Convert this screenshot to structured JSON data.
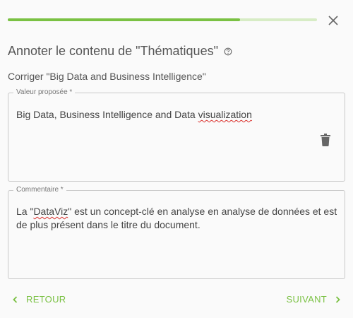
{
  "progress": {
    "fraction": 0.75
  },
  "header": {
    "title": "Annoter le contenu de \"Thématiques\"",
    "help_icon": "help-circle-icon",
    "close_icon": "close-icon"
  },
  "subtitle": "Corriger \"Big Data and Business Intelligence\"",
  "value_field": {
    "legend": "Valeur proposée *",
    "text_before": "Big Data, Business Intelligence and Data ",
    "text_misspelled": "visualization",
    "delete_icon": "trash-icon"
  },
  "comment_field": {
    "legend": "Commentaire *",
    "text_before": "La \"",
    "text_misspelled": "DataViz",
    "text_after": "\" est un concept-clé en analyse en analyse de données et est de plus présent dans le titre du document."
  },
  "nav": {
    "back_label": "RETOUR",
    "next_label": "SUIVANT"
  },
  "colors": {
    "accent": "#7ac143",
    "track": "#d7ecc5",
    "spellcheck": "#d9302c"
  }
}
